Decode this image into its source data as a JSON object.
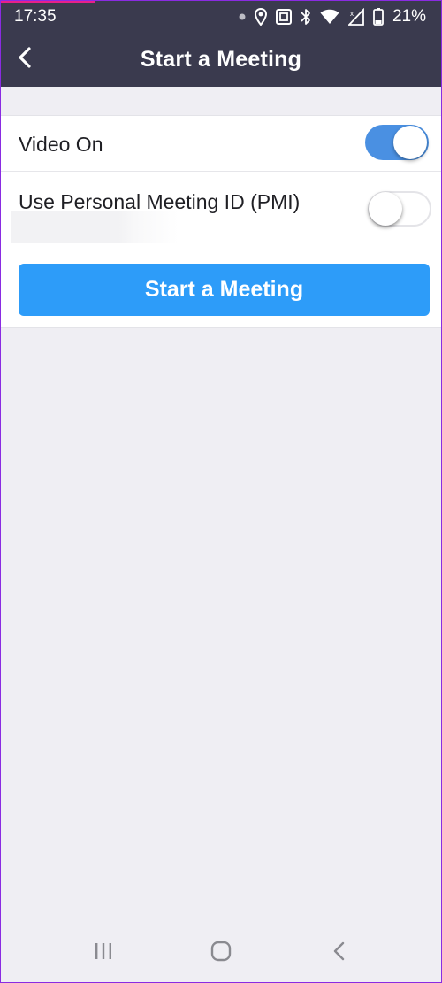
{
  "status_bar": {
    "time": "17:35",
    "battery_percent": "21%",
    "icons": [
      "dot-icon",
      "location-icon",
      "nfc-icon",
      "bluetooth-icon",
      "wifi-icon",
      "signal-icon",
      "battery-icon"
    ],
    "background": "#3a3a4e",
    "accent": "#e8208a"
  },
  "header": {
    "title": "Start a Meeting",
    "back_icon": "chevron-left-icon"
  },
  "settings": {
    "video_on": {
      "label": "Video On",
      "enabled": true
    },
    "use_pmi": {
      "label": "Use Personal Meeting ID (PMI)",
      "enabled": false
    }
  },
  "actions": {
    "start_label": "Start a Meeting",
    "start_color": "#2d9cf9"
  },
  "colors": {
    "toggle_on": "#4a90e2",
    "background": "#efeef3"
  },
  "nav_bar": {
    "icons": [
      "recent-apps-icon",
      "home-icon",
      "back-icon"
    ]
  }
}
